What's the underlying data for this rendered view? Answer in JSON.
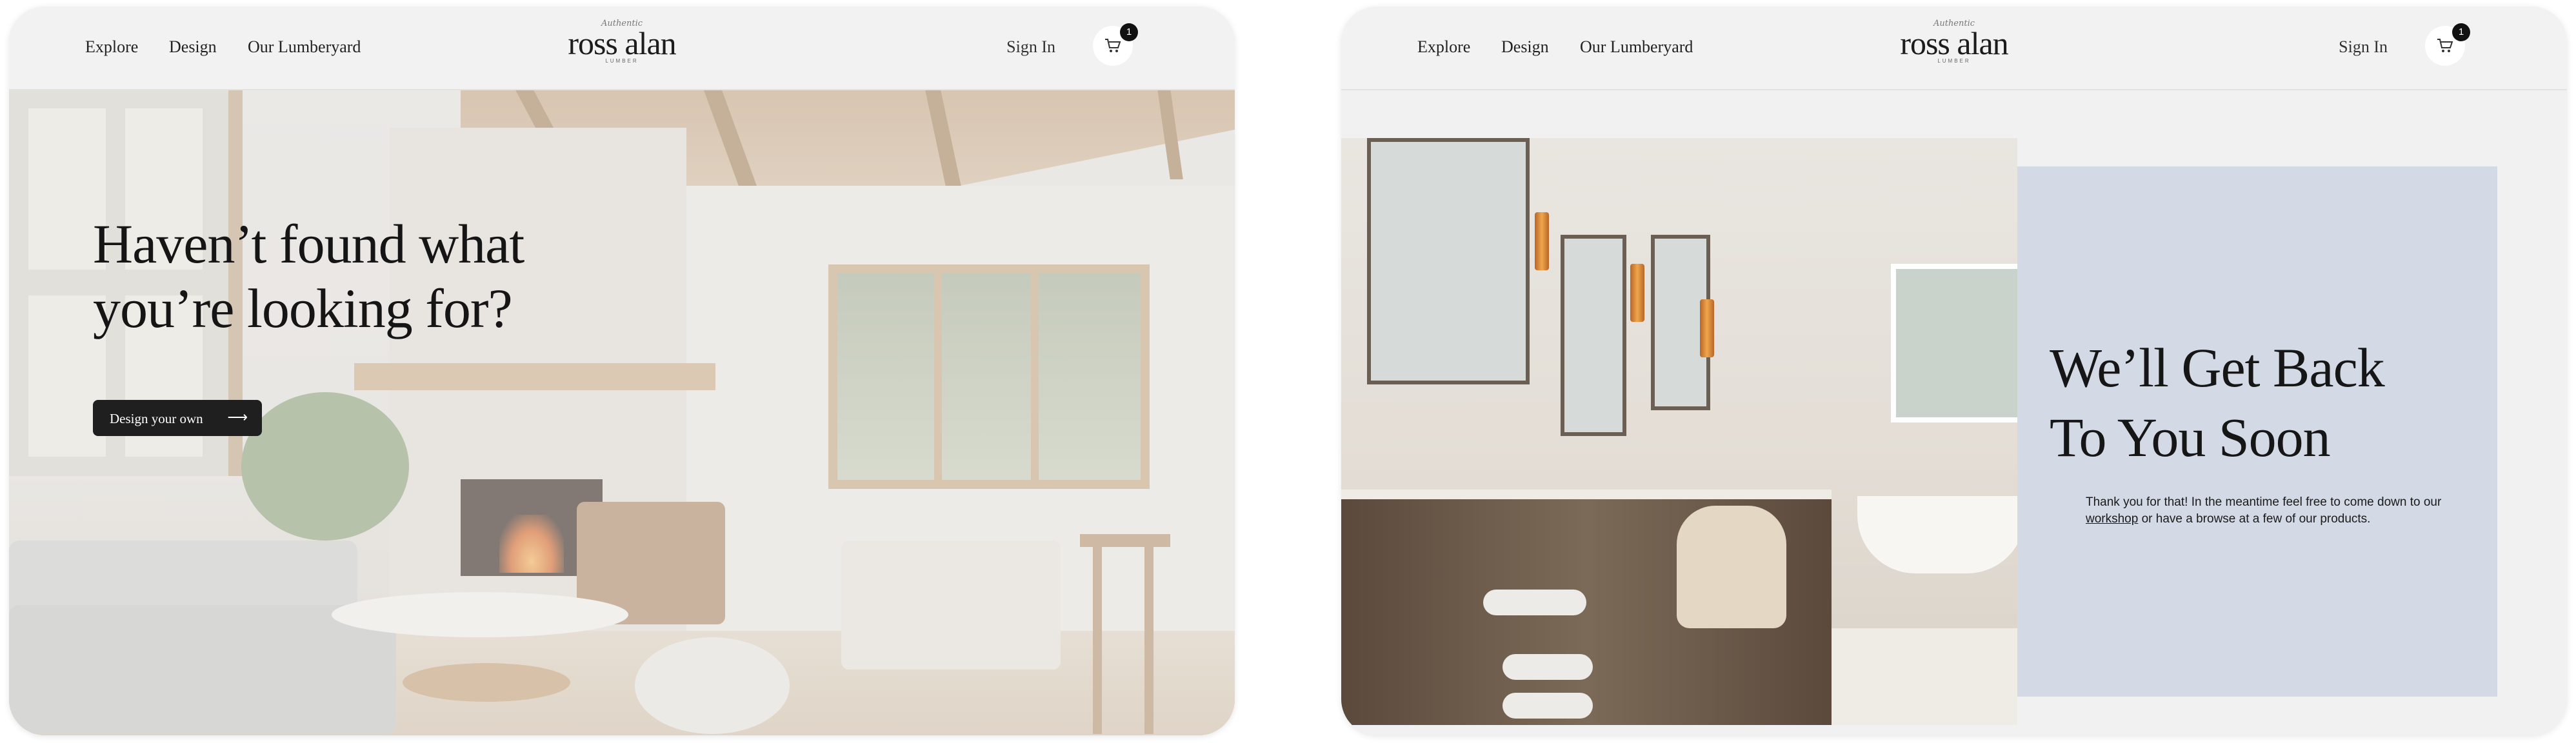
{
  "nav": {
    "links": [
      "Explore",
      "Design",
      "Our Lumberyard"
    ],
    "logo": {
      "script": "Authentic",
      "name": "ross alan",
      "sub": "LUMBER"
    },
    "sign_in": "Sign In",
    "cart_count": "1",
    "cart_icon": "cart-icon"
  },
  "hero": {
    "title_line1": "Haven’t found what",
    "title_line2": "you’re looking for?",
    "cta_label": "Design your own",
    "cta_icon": "arrow-right-icon"
  },
  "contact": {
    "title_line1": "We’ll Get Back",
    "title_line2": "To You Soon",
    "message_before": "Thank you for that! In the meantime feel free to come down to our ",
    "message_link": "workshop",
    "message_after": " or have a browse at a few of our products."
  },
  "colors": {
    "panel_bg": "#eeeeee",
    "button_bg": "#1f1f1f",
    "contact_box": "#d3dae5",
    "text": "#151515"
  }
}
